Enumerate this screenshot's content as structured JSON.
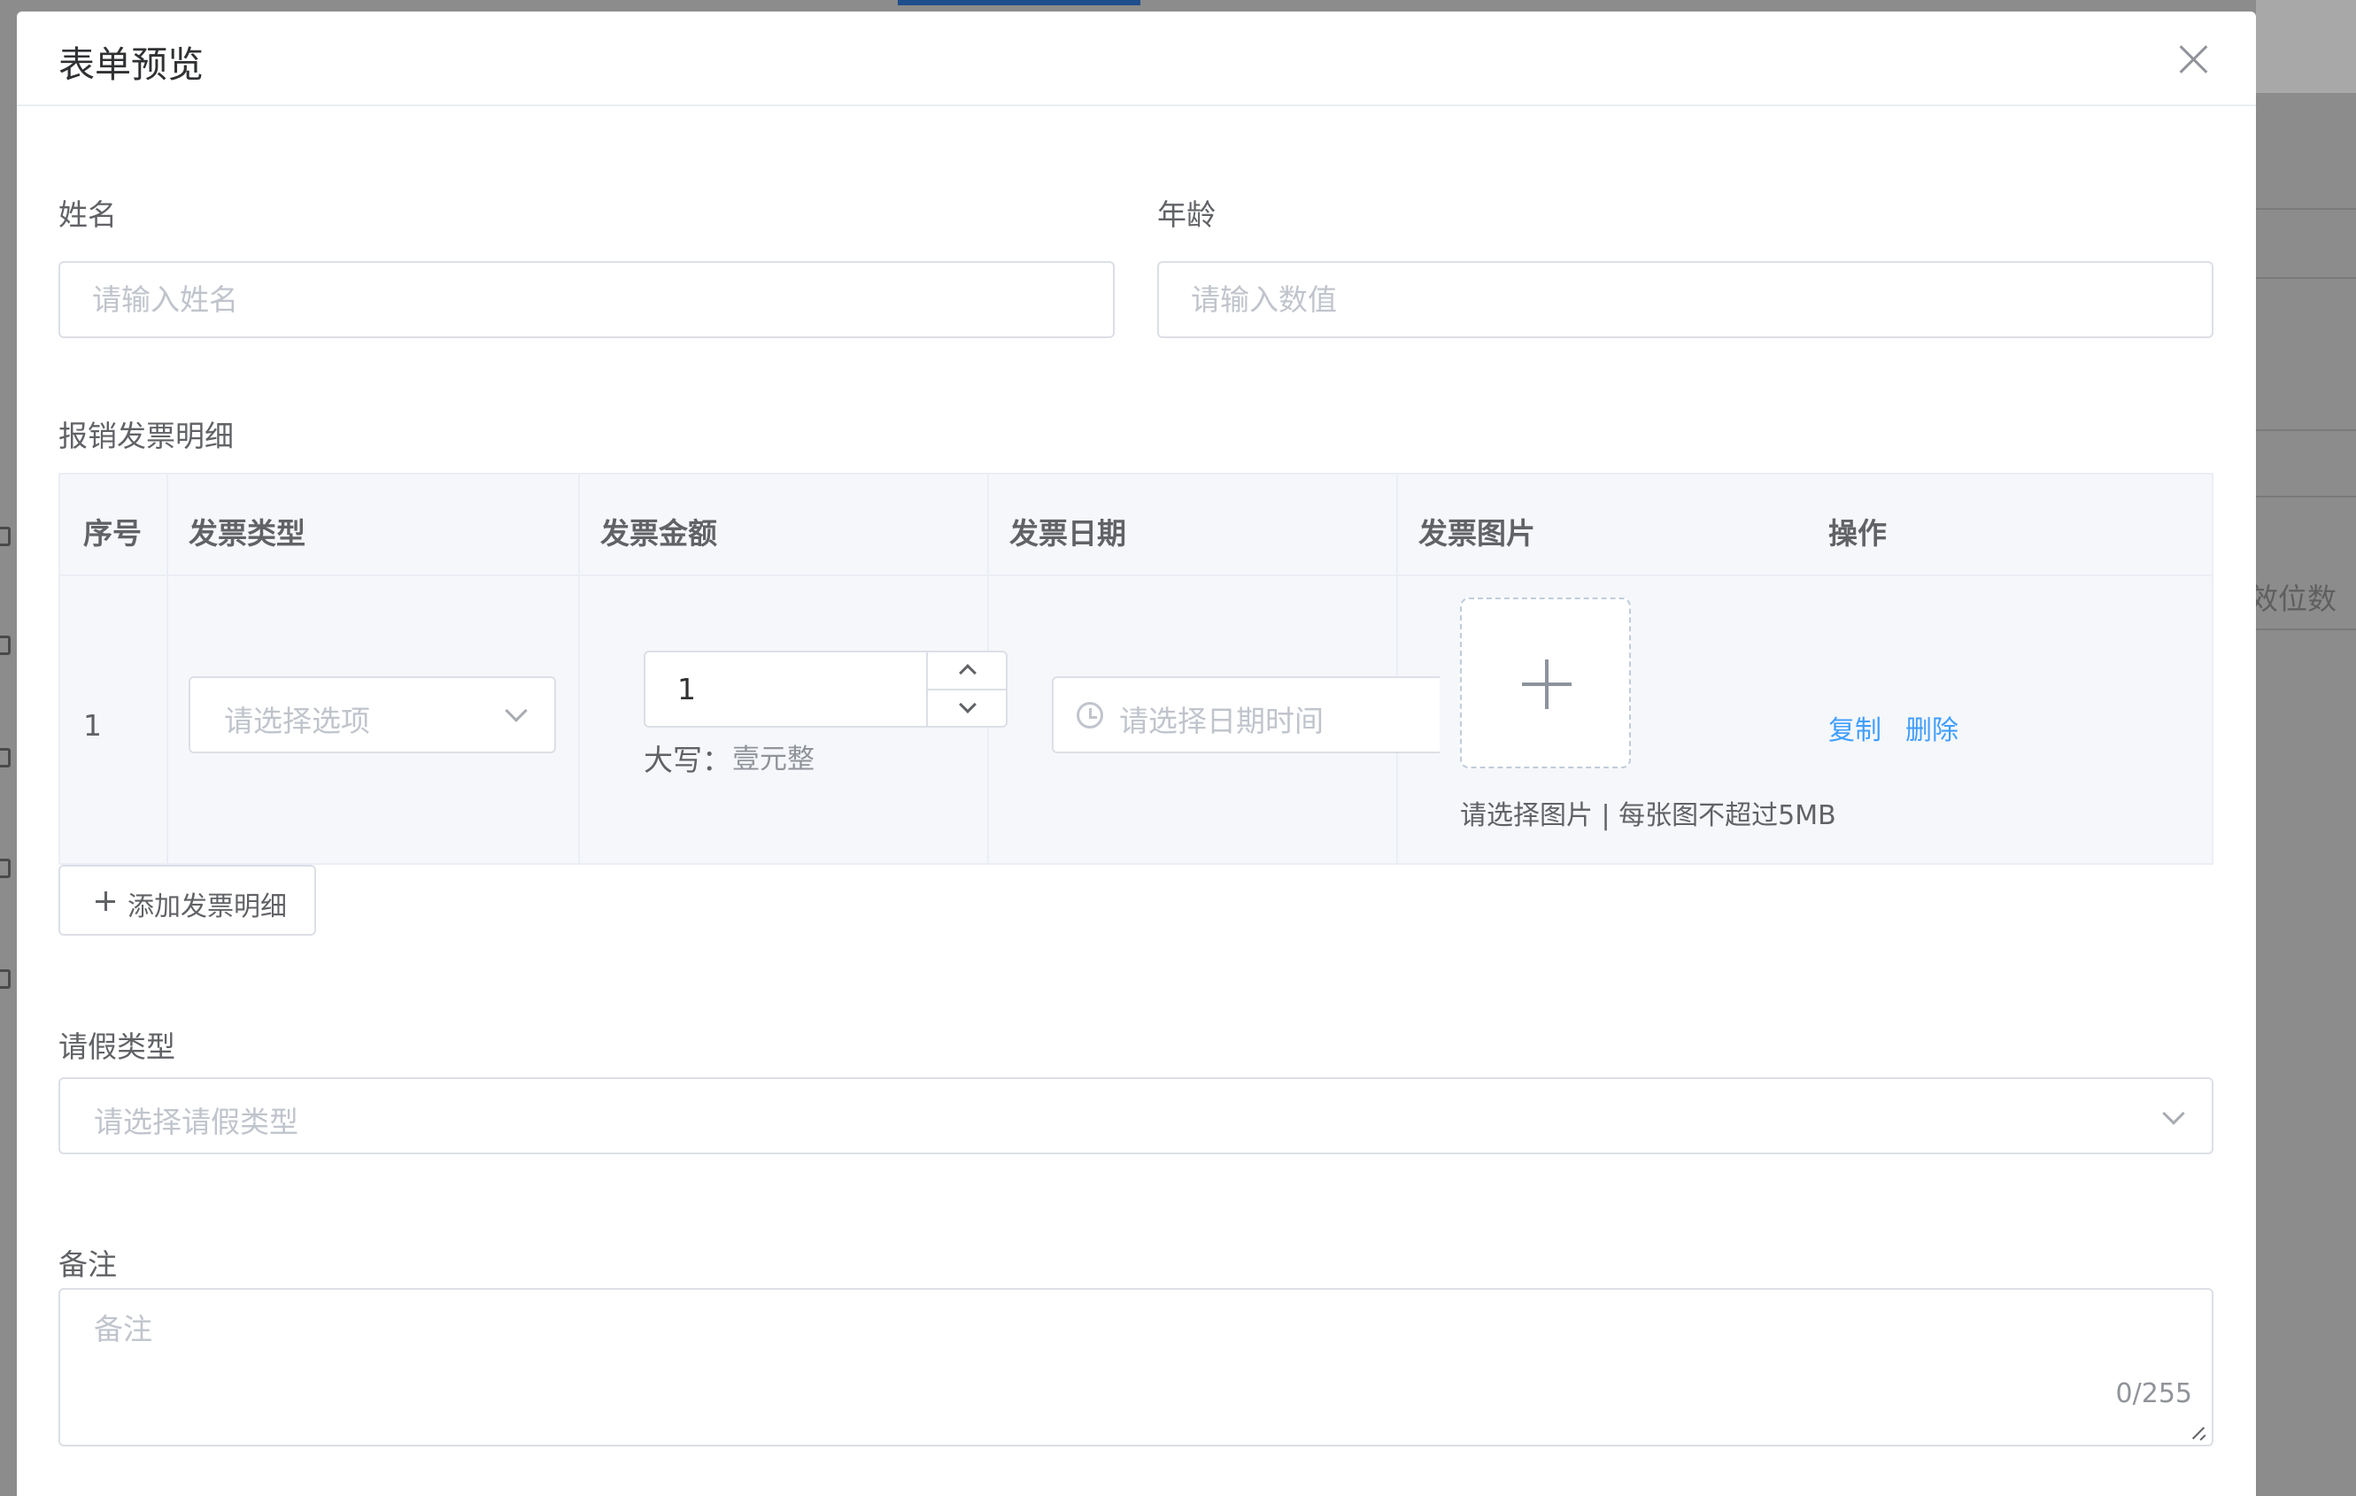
{
  "background": {
    "partial_text": "效位数"
  },
  "modal": {
    "title": "表单预览"
  },
  "form": {
    "name": {
      "label": "姓名",
      "placeholder": "请输入姓名"
    },
    "age": {
      "label": "年龄",
      "placeholder": "请输入数值"
    },
    "invoice_section_label": "报销发票明细",
    "invoice_table": {
      "headers": [
        "序号",
        "发票类型",
        "发票金额",
        "发票日期",
        "发票图片",
        "操作"
      ],
      "rows": [
        {
          "index": "1",
          "type_placeholder": "请选择选项",
          "amount": "1",
          "uppercase_label": "大写：",
          "uppercase_value": "壹元整",
          "date_placeholder": "请选择日期时间",
          "upload_tip": "请选择图片 | 每张图不超过5MB",
          "actions": {
            "copy": "复制",
            "delete": "删除"
          }
        }
      ],
      "add_button": "添加发票明细"
    },
    "leave_type": {
      "label": "请假类型",
      "placeholder": "请选择请假类型"
    },
    "remark": {
      "label": "备注",
      "placeholder": "备注",
      "counter": "0/255"
    }
  }
}
